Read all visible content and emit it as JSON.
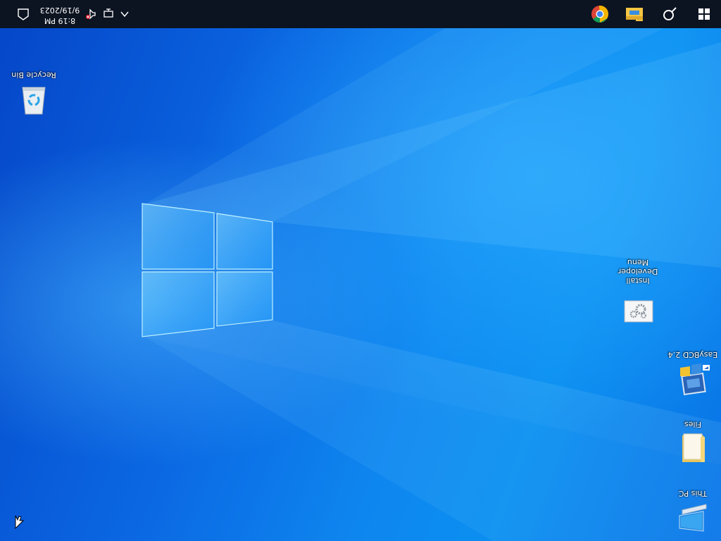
{
  "taskbar": {
    "time": "8:19 PM",
    "date": "9/19/2023",
    "pinned": [
      "start-icon",
      "search-icon",
      "file-explorer-icon",
      "chrome-icon"
    ],
    "tray": [
      "show-hidden-icons-chevron",
      "network-icon",
      "volume-muted-icon"
    ],
    "notification": "action-center-icon",
    "background_color": "#0c1421"
  },
  "desktop": {
    "background_color": "#0a6fe0",
    "orientation": "rotated 180 degrees",
    "icons": [
      {
        "label": "Recycle Bin",
        "icon": "recycle-bin-icon"
      },
      {
        "label": "Install Developer Menu",
        "icon": "settings-gear-icon"
      },
      {
        "label": "EasyBCD 2.4",
        "icon": "easybcd-icon"
      },
      {
        "label": "Files",
        "icon": "folder-icon"
      },
      {
        "label": "This PC",
        "icon": "computer-icon"
      }
    ]
  }
}
